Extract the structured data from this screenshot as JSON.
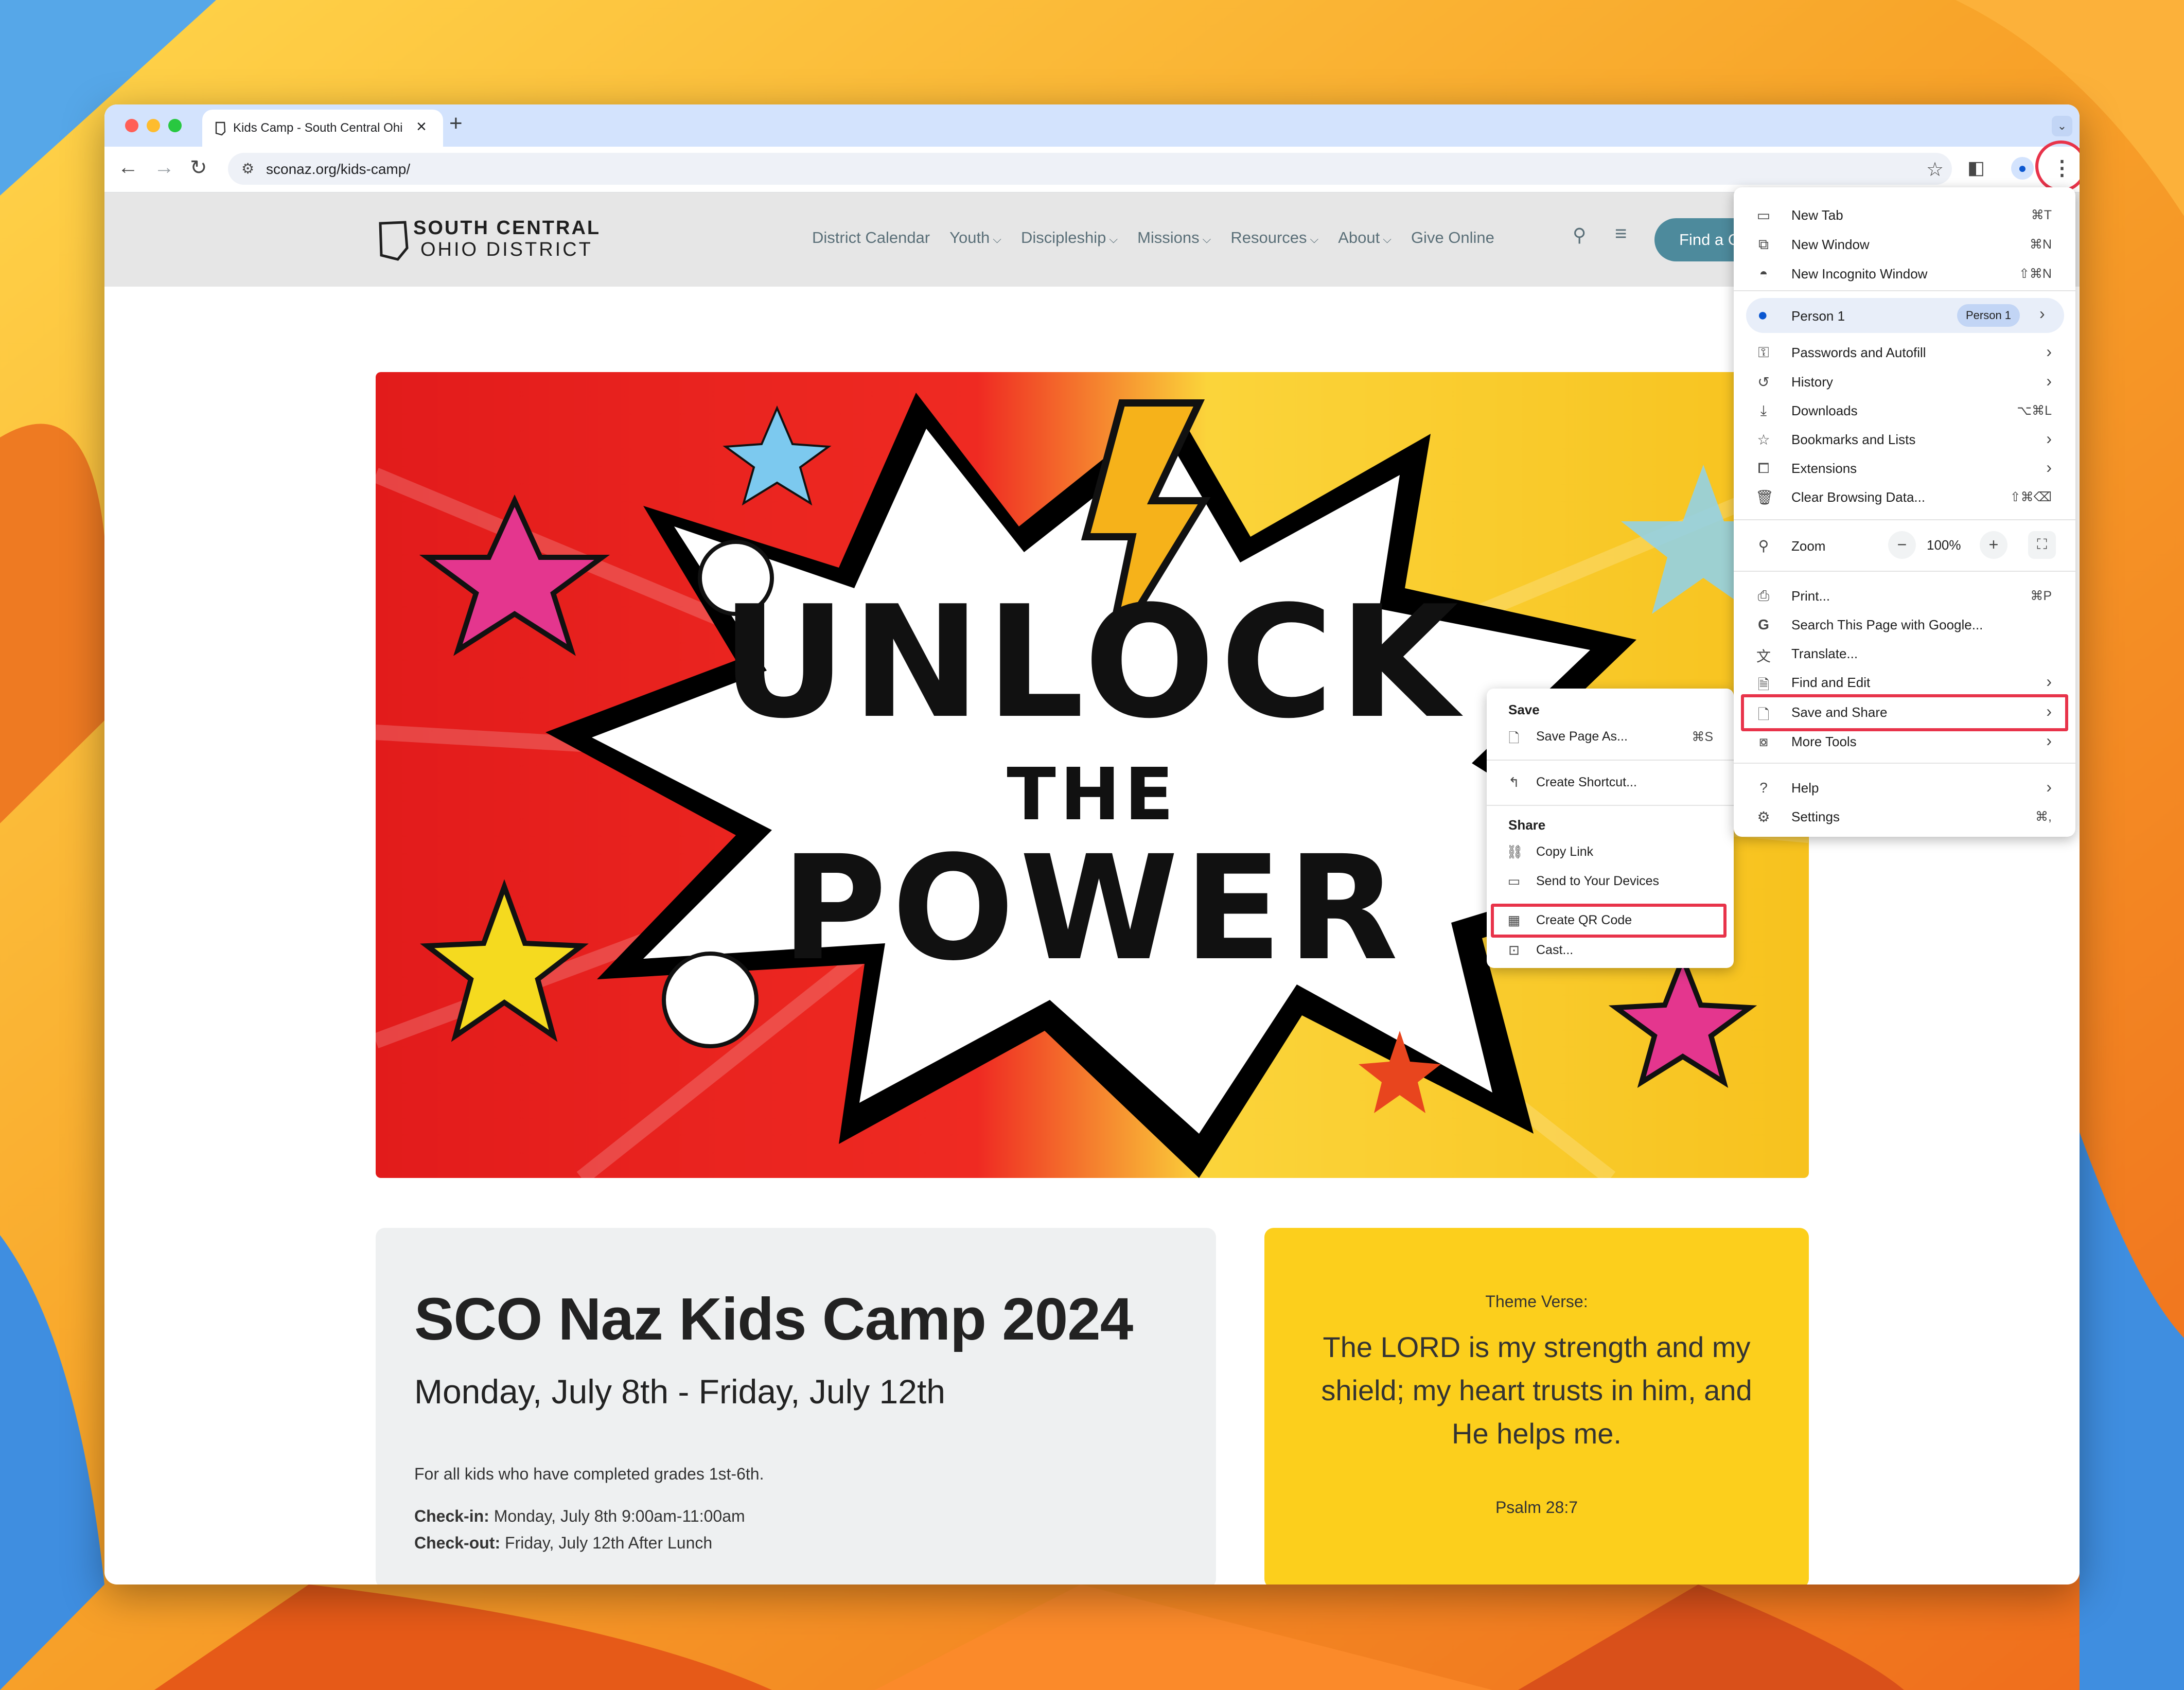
{
  "browser": {
    "tab_title": "Kids Camp - South Central Ohio District",
    "url": "sconaz.org/kids-camp/"
  },
  "site": {
    "logo_line1": "SOUTH CENTRAL",
    "logo_line2": "OHIO DISTRICT",
    "nav": [
      {
        "label": "District Calendar",
        "dropdown": false
      },
      {
        "label": "Youth",
        "dropdown": true
      },
      {
        "label": "Discipleship",
        "dropdown": true
      },
      {
        "label": "Missions",
        "dropdown": true
      },
      {
        "label": "Resources",
        "dropdown": true
      },
      {
        "label": "About",
        "dropdown": true
      },
      {
        "label": "Give Online",
        "dropdown": false
      }
    ],
    "cta_label": "Find a Church"
  },
  "hero": {
    "line1": "UNLOCK",
    "line2": "THE",
    "line3": "POWER"
  },
  "camp": {
    "title": "SCO Naz Kids Camp 2024",
    "dates": "Monday, July 8th - Friday, July 12th",
    "who": "For all kids who have completed grades 1st-6th.",
    "checkin_label": "Check-in:",
    "checkin_value": "Monday, July 8th 9:00am-11:00am",
    "checkout_label": "Check-out:",
    "checkout_value": "Friday, July 12th After Lunch"
  },
  "verse": {
    "label": "Theme Verse:",
    "text": "The LORD is my strength and my shield; my heart trusts in him, and He helps me.",
    "reference": "Psalm 28:7"
  },
  "chrome_menu": {
    "new_tab": {
      "label": "New Tab",
      "shortcut": "⌘T"
    },
    "new_window": {
      "label": "New Window",
      "shortcut": "⌘N"
    },
    "new_incognito": {
      "label": "New Incognito Window",
      "shortcut": "⇧⌘N"
    },
    "person_name": "Person 1",
    "person_badge": "Person 1",
    "passwords": {
      "label": "Passwords and Autofill"
    },
    "history": {
      "label": "History"
    },
    "downloads": {
      "label": "Downloads",
      "shortcut": "⌥⌘L"
    },
    "bookmarks": {
      "label": "Bookmarks and Lists"
    },
    "extensions": {
      "label": "Extensions"
    },
    "clear_data": {
      "label": "Clear Browsing Data...",
      "shortcut": "⇧⌘⌫"
    },
    "zoom_label": "Zoom",
    "zoom_minus": "−",
    "zoom_value": "100%",
    "zoom_plus": "+",
    "print": {
      "label": "Print...",
      "shortcut": "⌘P"
    },
    "search_page": {
      "label": "Search This Page with Google..."
    },
    "translate": {
      "label": "Translate..."
    },
    "find_edit": {
      "label": "Find and Edit"
    },
    "save_share": {
      "label": "Save and Share"
    },
    "more_tools": {
      "label": "More Tools"
    },
    "help": {
      "label": "Help"
    },
    "settings": {
      "label": "Settings",
      "shortcut": "⌘,"
    }
  },
  "save_share_submenu": {
    "save_heading": "Save",
    "save_page": {
      "label": "Save Page As...",
      "shortcut": "⌘S"
    },
    "create_shortcut": {
      "label": "Create Shortcut..."
    },
    "share_heading": "Share",
    "copy_link": {
      "label": "Copy Link"
    },
    "send_devices": {
      "label": "Send to Your Devices"
    },
    "qr_code": {
      "label": "Create QR Code"
    },
    "cast": {
      "label": "Cast..."
    }
  },
  "colors": {
    "highlight": "#e8334a",
    "tabstrip": "#d3e3fd",
    "verse_card": "#fccf1c",
    "camp_card": "#eef0f1",
    "cta": "#4d8a9c"
  }
}
